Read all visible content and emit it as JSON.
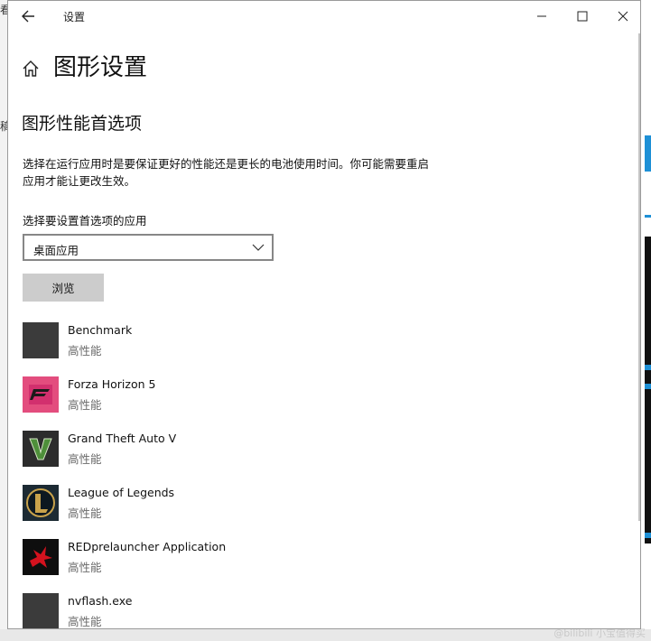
{
  "window": {
    "title": "设置",
    "controls": [
      "minimize",
      "maximize",
      "close"
    ]
  },
  "header": {
    "title": "图形设置",
    "icon": "home-icon"
  },
  "section": {
    "title": "图形性能首选项",
    "description": "选择在运行应用时是要保证更好的性能还是更长的电池使用时间。你可能需要重启应用才能让更改生效。"
  },
  "selector": {
    "label": "选择要设置首选项的应用",
    "value": "桌面应用",
    "browse_label": "浏览"
  },
  "apps": [
    {
      "name": "Benchmark",
      "preference": "高性能",
      "icon": "blank-app-icon"
    },
    {
      "name": "Forza Horizon 5",
      "preference": "高性能",
      "icon": "forza-horizon-icon"
    },
    {
      "name": "Grand Theft Auto V",
      "preference": "高性能",
      "icon": "gta-v-icon"
    },
    {
      "name": "League of Legends",
      "preference": "高性能",
      "icon": "league-of-legends-icon"
    },
    {
      "name": "REDprelauncher Application",
      "preference": "高性能",
      "icon": "redprelauncher-icon"
    },
    {
      "name": "nvflash.exe",
      "preference": "高性能",
      "icon": "blank-app-icon"
    }
  ],
  "background": {
    "left_fragments": [
      "看",
      "稿"
    ],
    "watermark": "@bilibili 小宝值得买"
  },
  "colors": {
    "window_bg": "#ffffff",
    "button_bg": "#cccccc",
    "accent_blue": "#1e90d6",
    "secondary_text": "#6b6b6b"
  }
}
